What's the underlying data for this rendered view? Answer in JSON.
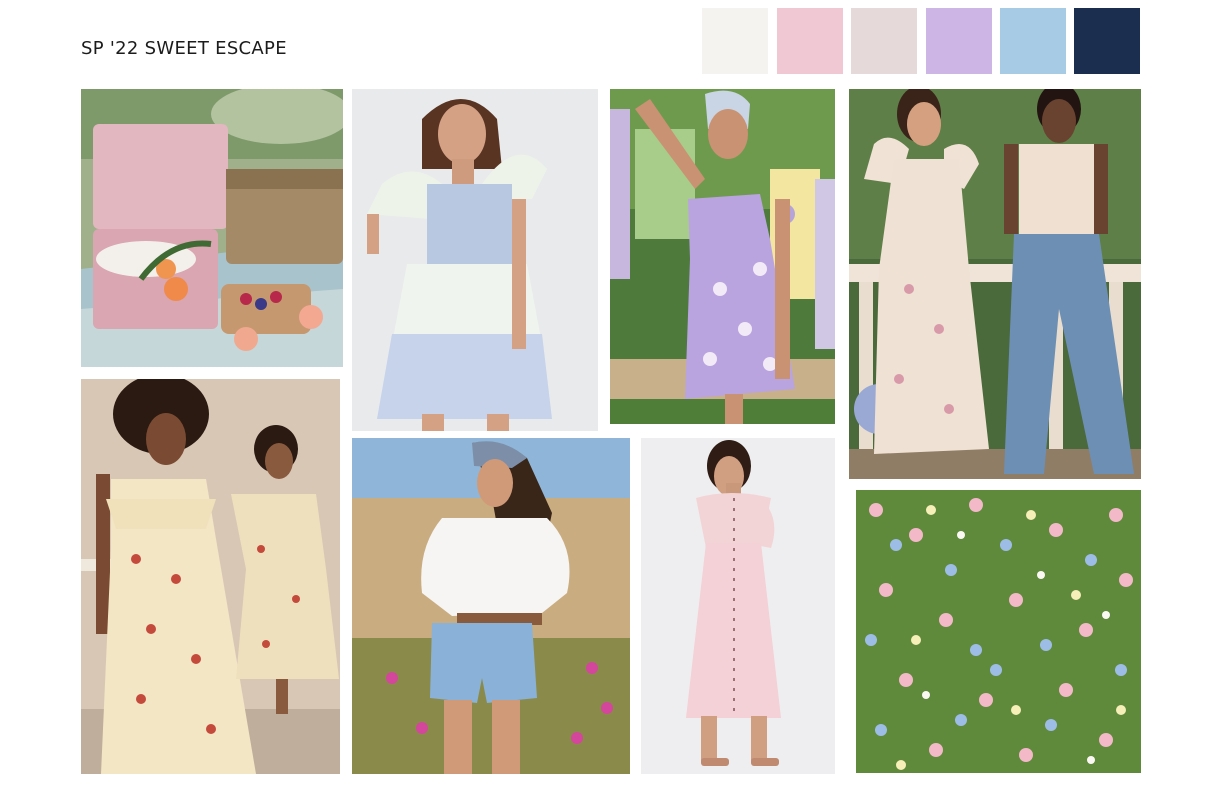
{
  "board": {
    "title": "SP '22 SWEET ESCAPE"
  },
  "palette": [
    {
      "name": "ivory",
      "color": "#f4f3f0"
    },
    {
      "name": "blush-pink",
      "color": "#efc8d4"
    },
    {
      "name": "greige",
      "color": "#e5d9d9"
    },
    {
      "name": "lavender",
      "color": "#cdb5e5"
    },
    {
      "name": "sky-blue",
      "color": "#a8cbe5"
    },
    {
      "name": "navy-denim",
      "color": "#1c2e4f"
    }
  ],
  "photos": [
    {
      "name": "picnic-baskets"
    },
    {
      "name": "blue-floral-tiered-dress"
    },
    {
      "name": "lavender-daisy-slip-dress"
    },
    {
      "name": "floral-milkmaid-dress-and-jeans"
    },
    {
      "name": "cream-block-print-dresses"
    },
    {
      "name": "white-peasant-top-denim-shorts"
    },
    {
      "name": "pink-button-front-midi-dress"
    },
    {
      "name": "pastel-flower-field"
    }
  ]
}
